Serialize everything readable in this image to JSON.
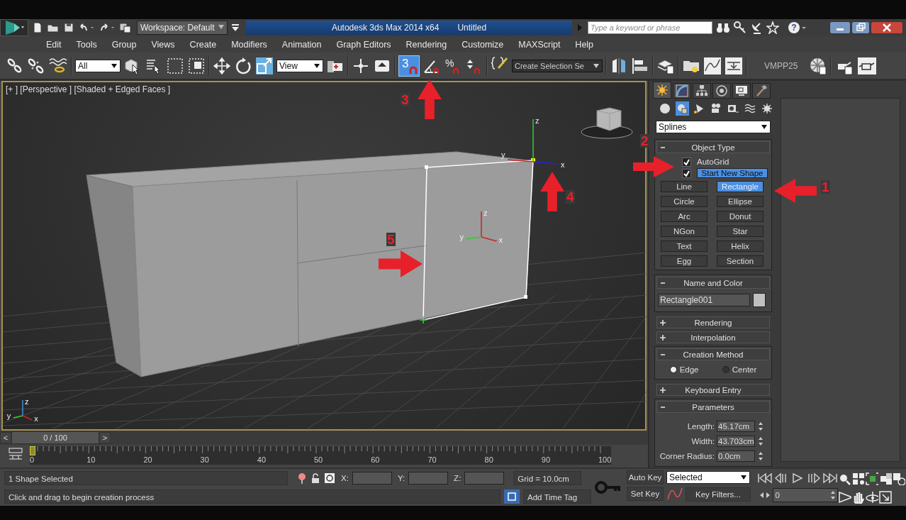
{
  "title_bar": {
    "workspace": "Workspace: Default",
    "app_name": "Autodesk 3ds Max  2014 x64",
    "document": "Untitled",
    "search": {
      "placeholder": "Type a keyword or phrase"
    },
    "help_glyph": "?"
  },
  "menu": [
    "Edit",
    "Tools",
    "Group",
    "Views",
    "Create",
    "Modifiers",
    "Animation",
    "Graph Editors",
    "Rendering",
    "Customize",
    "MAXScript",
    "Help"
  ],
  "toolbar": {
    "selection_filter": "All",
    "reference_coordinate": "View",
    "snap_toggle": {
      "label": "3",
      "on": true
    },
    "percent_snap_glyph": "%",
    "selection_set": "Create Selection Se",
    "plugin_label": "VMPP25"
  },
  "viewport": {
    "label": "[+ ] [Perspective ] [Shaded + Edged Faces ]",
    "active": true,
    "gizmos": [
      {
        "z": "z",
        "y": "y",
        "x": "x"
      },
      {
        "z": "z",
        "y": "y",
        "x": "x"
      },
      {
        "z": "z",
        "y": "y",
        "x": "x"
      }
    ]
  },
  "annotations": [
    {
      "number": "1",
      "kind": "left"
    },
    {
      "number": "2",
      "kind": "right"
    },
    {
      "number": "3",
      "kind": "up"
    },
    {
      "number": "4",
      "kind": "up"
    },
    {
      "number": "5",
      "kind": "right"
    }
  ],
  "command_panel": {
    "tabs": [
      {
        "selected": true
      },
      {
        "selected": false
      },
      {
        "selected": false
      },
      {
        "selected": false
      },
      {
        "selected": false
      },
      {
        "selected": false
      }
    ],
    "categories": [
      {
        "selected": false
      },
      {
        "selected": true
      },
      {
        "selected": false
      },
      {
        "selected": false
      },
      {
        "selected": false
      },
      {
        "selected": false
      },
      {
        "selected": false
      }
    ],
    "category_dropdown": "Splines",
    "object_type": {
      "title": "Object Type",
      "expanded": true,
      "autogrid": {
        "label": "AutoGrid",
        "checked": true
      },
      "start_new_shape": {
        "label": "Start New Shape",
        "checked": true
      },
      "buttons": [
        {
          "label": "Line",
          "selected": false
        },
        {
          "label": "Rectangle",
          "selected": true
        },
        {
          "label": "Circle",
          "selected": false
        },
        {
          "label": "Ellipse",
          "selected": false
        },
        {
          "label": "Arc",
          "selected": false
        },
        {
          "label": "Donut",
          "selected": false
        },
        {
          "label": "NGon",
          "selected": false
        },
        {
          "label": "Star",
          "selected": false
        },
        {
          "label": "Text",
          "selected": false
        },
        {
          "label": "Helix",
          "selected": false
        },
        {
          "label": "Egg",
          "selected": false
        },
        {
          "label": "Section",
          "selected": false
        }
      ]
    },
    "name_and_color": {
      "title": "Name and Color",
      "expanded": true,
      "name": "Rectangle001",
      "color": "#c0c0c0"
    },
    "rendering": {
      "title": "Rendering",
      "expanded": false
    },
    "interpolation": {
      "title": "Interpolation",
      "expanded": false
    },
    "creation_method": {
      "title": "Creation Method",
      "expanded": true,
      "options": [
        {
          "label": "Edge",
          "selected": true
        },
        {
          "label": "Center",
          "selected": false
        }
      ]
    },
    "keyboard_entry": {
      "title": "Keyboard Entry",
      "expanded": false
    },
    "parameters": {
      "title": "Parameters",
      "expanded": true,
      "fields": [
        {
          "label": "Length:",
          "value": "45.17cm"
        },
        {
          "label": "Width:",
          "value": "43.703cm"
        },
        {
          "label": "Corner Radius:",
          "value": "0.0cm"
        }
      ]
    }
  },
  "time_slider": {
    "prev": "<",
    "position": "0 / 100",
    "next": ">"
  },
  "track_bar": {
    "frame_labels": [
      "0",
      "10",
      "20",
      "30",
      "40",
      "50",
      "60",
      "70",
      "80",
      "90",
      "100"
    ]
  },
  "status_bar": {
    "selection": "1 Shape Selected",
    "prompt": "Click and drag to begin creation process",
    "x_label": "X:",
    "y_label": "Y:",
    "z_label": "Z:",
    "grid": "Grid = 10.0cm",
    "add_time_tag": "Add Time Tag",
    "auto_key": "Auto Key",
    "set_key": "Set Key",
    "key_mode": "Selected",
    "key_filters": "Key Filters...",
    "current_frame": "0"
  }
}
